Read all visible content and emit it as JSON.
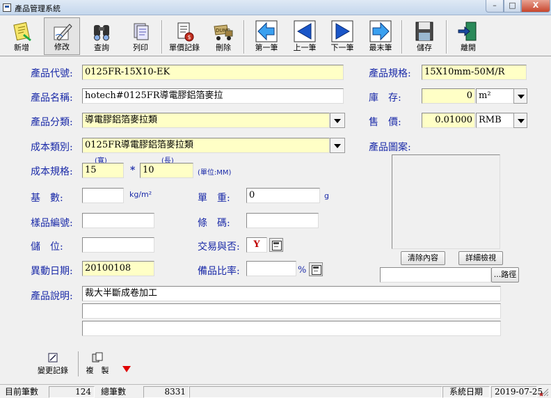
{
  "window": {
    "title": "產品管理系統",
    "min": "–",
    "max": "□",
    "close": "X"
  },
  "toolbar": {
    "add": "新增",
    "edit": "修改",
    "query": "查詢",
    "print": "列印",
    "price_log": "單價記錄",
    "delete": "刪除",
    "first": "第一筆",
    "prev": "上一筆",
    "next": "下一筆",
    "last": "最末筆",
    "save": "儲存",
    "exit": "離開"
  },
  "form": {
    "code_label": "產品代號:",
    "code": "0125FR-15X10-EK",
    "spec_label": "產品規格:",
    "spec": "15X10mm-50M/R",
    "name_label": "產品名稱:",
    "name": "hotech#0125FR導電膠鋁箔麥拉",
    "stock_label": "庫　存:",
    "stock": "0",
    "stock_unit": "m²",
    "category_label": "產品分類:",
    "category": "導電膠鋁箔麥拉類",
    "price_label": "售　價:",
    "price": "0.01000",
    "currency": "RMB",
    "cost_type_label": "成本類別:",
    "cost_type": "0125FR導電膠鋁箔麥拉類",
    "image_label": "產品圖案:",
    "cost_spec_label": "成本規格:",
    "width_caption": "(寬)",
    "width": "15",
    "times": "*",
    "length_caption": "(長)",
    "length": "10",
    "unit_caption": "(單位:MM)",
    "base_label": "基　數:",
    "base": "",
    "base_unit": "kg/m²",
    "unit_weight_label": "單　重:",
    "unit_weight": "0",
    "unit_weight_unit": "g",
    "sample_no_label": "樣品編號:",
    "sample_no": "",
    "barcode_label": "條　碼:",
    "barcode": "",
    "storage_label": "儲　位:",
    "storage": "",
    "tradeable_label": "交易與否:",
    "tradeable": "Y",
    "change_date_label": "異動日期:",
    "change_date": "20100108",
    "spare_rate_label": "備品比率:",
    "spare_rate": "",
    "percent": "%",
    "clear_btn": "清除內容",
    "detail_btn": "詳細檢視",
    "path_value": "",
    "path_btn": "...路徑",
    "desc_label": "產品說明:",
    "desc1": "裁大半斷成卷加工",
    "desc2": "",
    "desc3": ""
  },
  "bottom": {
    "change_log": "變更記錄",
    "copy": "複　製"
  },
  "status": {
    "current_label": "目前筆數",
    "current": "124",
    "total_label": "總筆數",
    "total": "8331",
    "date_label": "系統日期",
    "date": "2019-07-25"
  },
  "colors": {
    "label_blue": "#1a2aa8",
    "field_yellow": "#ffffc6",
    "tradeable_red": "#c00000"
  }
}
